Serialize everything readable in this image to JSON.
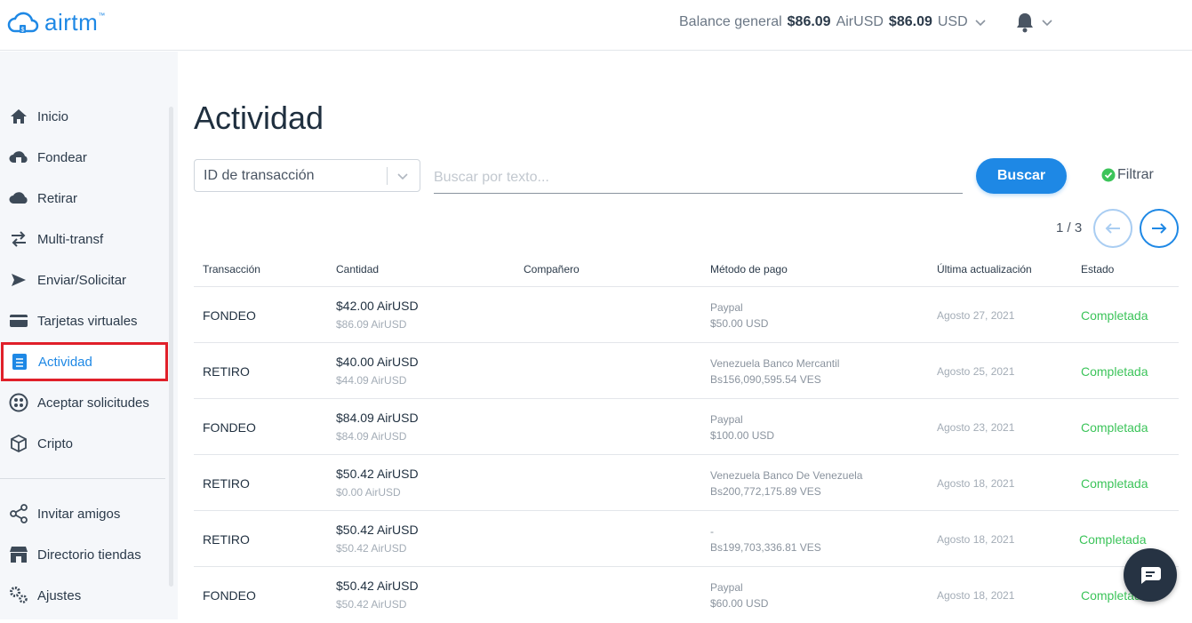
{
  "app": {
    "logo_text": "airtm",
    "logo_tm": "™"
  },
  "header": {
    "balance_label": "Balance general",
    "airusd_amount": "$86.09",
    "airusd_currency": "AirUSD",
    "usd_amount": "$86.09",
    "usd_currency": "USD"
  },
  "sidebar": {
    "items": [
      {
        "label": "Inicio",
        "icon": "home-icon"
      },
      {
        "label": "Fondear",
        "icon": "cloud-upload-icon"
      },
      {
        "label": "Retirar",
        "icon": "cloud-download-icon"
      },
      {
        "label": "Multi-transf",
        "icon": "transfer-icon"
      },
      {
        "label": "Enviar/Solicitar",
        "icon": "send-icon"
      },
      {
        "label": "Tarjetas virtuales",
        "icon": "card-icon"
      },
      {
        "label": "Actividad",
        "icon": "list-icon",
        "active": true
      },
      {
        "label": "Aceptar solicitudes",
        "icon": "requests-icon"
      },
      {
        "label": "Cripto",
        "icon": "cube-icon"
      }
    ],
    "bottom_items": [
      {
        "label": "Invitar amigos",
        "icon": "share-icon"
      },
      {
        "label": "Directorio tiendas",
        "icon": "store-icon"
      },
      {
        "label": "Ajustes",
        "icon": "settings-icon"
      }
    ]
  },
  "main": {
    "title": "Actividad",
    "select_value": "ID de transacción",
    "search_placeholder": "Buscar por texto...",
    "search_button": "Buscar",
    "filter_label": "Filtrar",
    "pager": "1 / 3"
  },
  "table": {
    "headers": [
      "Transacción",
      "Cantidad",
      "Compañero",
      "Método de pago",
      "Última actualización",
      "Estado"
    ],
    "rows": [
      {
        "type": "FONDEO",
        "amount": "$42.00 AirUSD",
        "balance": "$86.09 AirUSD",
        "method": "Paypal",
        "method_amount": "$50.00 USD",
        "date": "Agosto 27, 2021",
        "state": "Completada"
      },
      {
        "type": "RETIRO",
        "amount": "$40.00 AirUSD",
        "balance": "$44.09 AirUSD",
        "method": "Venezuela Banco Mercantil",
        "method_amount": "Bs156,090,595.54 VES",
        "date": "Agosto 25, 2021",
        "state": "Completada"
      },
      {
        "type": "FONDEO",
        "amount": "$84.09 AirUSD",
        "balance": "$84.09 AirUSD",
        "method": "Paypal",
        "method_amount": "$100.00 USD",
        "date": "Agosto 23, 2021",
        "state": "Completada"
      },
      {
        "type": "RETIRO",
        "amount": "$50.42 AirUSD",
        "balance": "$0.00 AirUSD",
        "method": "Venezuela Banco De Venezuela",
        "method_amount": "Bs200,772,175.89 VES",
        "date": "Agosto 18, 2021",
        "state": "Completada"
      },
      {
        "type": "RETIRO",
        "amount": "$50.42 AirUSD",
        "balance": "$50.42 AirUSD",
        "method": "-",
        "method_amount": "Bs199,703,336.81 VES",
        "date": "Agosto 18, 2021",
        "state": "Completada"
      },
      {
        "type": "FONDEO",
        "amount": "$50.42 AirUSD",
        "balance": "$50.42 AirUSD",
        "method": "Paypal",
        "method_amount": "$60.00 USD",
        "date": "Agosto 18, 2021",
        "state": "Completada"
      }
    ]
  },
  "colors": {
    "accent": "#1e88e5",
    "success": "#3cc45a",
    "highlight": "#e0202a"
  }
}
